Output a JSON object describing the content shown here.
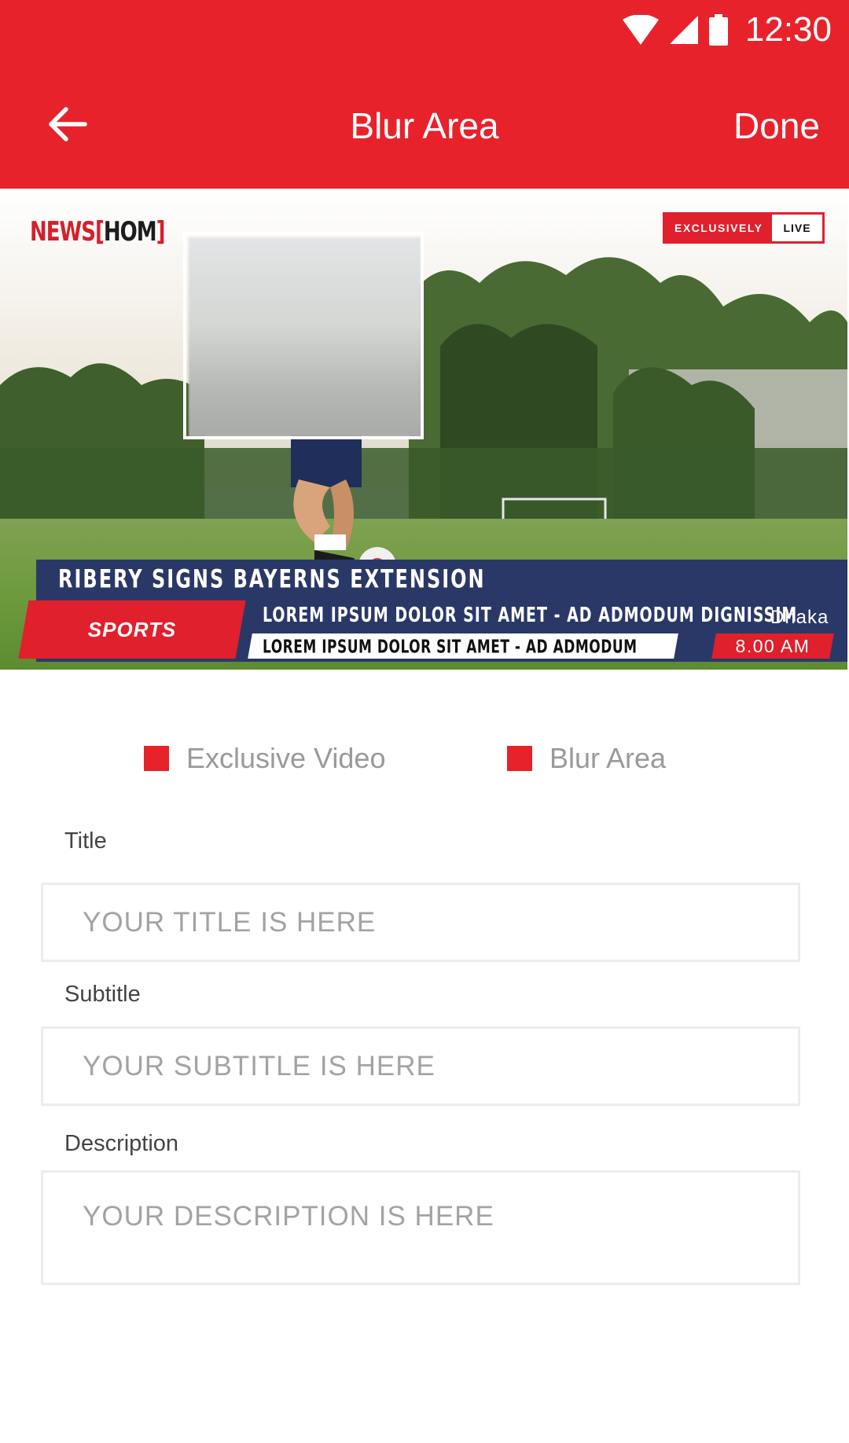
{
  "status_bar": {
    "time": "12:30",
    "icons": [
      "wifi-icon",
      "cell-signal-icon",
      "battery-icon"
    ]
  },
  "toolbar": {
    "title": "Blur Area",
    "done_label": "Done",
    "back_icon": "arrow-left-icon"
  },
  "preview": {
    "logo": {
      "word": "NEWS",
      "bracket_open": "[",
      "brand": "HOM",
      "bracket_close": "]"
    },
    "badge": {
      "left": "EXCLUSIVELY",
      "right": "LIVE"
    },
    "headline": "RIBERY SIGNS BAYERNS EXTENSION",
    "category": "SPORTS",
    "ticker_1": "LOREM IPSUM DOLOR SIT AMET - AD ADMODUM DIGNISSIM",
    "ticker_2": "LOREM IPSUM DOLOR SIT AMET - AD ADMODUM",
    "city": "Dhaka",
    "time": "8.00 AM"
  },
  "options": [
    {
      "label": "Exclusive Video"
    },
    {
      "label": "Blur Area"
    }
  ],
  "form": {
    "title_label": "Title",
    "title_placeholder": "YOUR TITLE IS HERE",
    "subtitle_label": "Subtitle",
    "subtitle_placeholder": "YOUR SUBTITLE IS HERE",
    "description_label": "Description",
    "description_placeholder": "YOUR DESCRIPTION IS HERE"
  },
  "colors": {
    "primary": "#e8222b",
    "lower_third_navy": "#2a3868"
  }
}
